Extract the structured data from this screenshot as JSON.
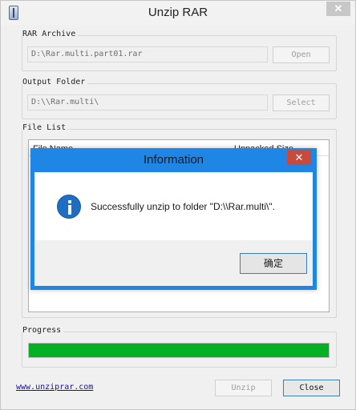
{
  "window": {
    "title": "Unzip RAR",
    "close_glyph": "✕"
  },
  "archive": {
    "label": "RAR Archive",
    "path": "D:\\Rar.multi.part01.rar",
    "open_label": "Open"
  },
  "output": {
    "label": "Output Folder",
    "path": "D:\\\\Rar.multi\\",
    "select_label": "Select"
  },
  "file_list": {
    "label": "File List",
    "columns": [
      "File Name",
      "Unpacked Size"
    ]
  },
  "progress": {
    "label": "Progress",
    "value_percent": 100,
    "color": "#06b025"
  },
  "footer": {
    "link_text": "www.unziprar.com",
    "unzip_label": "Unzip",
    "close_label": "Close"
  },
  "dialog": {
    "title": "Information",
    "message": "Successfully unzip to folder \"D:\\\\Rar.multi\\\".",
    "ok_label": "确定",
    "icon": "info-icon",
    "close_glyph": "✕",
    "accent": "#1f86e6"
  }
}
